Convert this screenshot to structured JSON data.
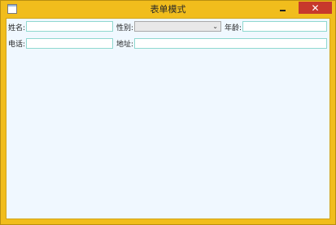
{
  "window": {
    "title": "表单模式"
  },
  "titlebar": {
    "min_icon": "minimize-icon",
    "max_icon": "maximize-icon",
    "close_label": "✕"
  },
  "form": {
    "name_label": "姓名:",
    "name_value": "",
    "gender_label": "性别:",
    "gender_value": "",
    "age_label": "年龄:",
    "age_value": "",
    "phone_label": "电话:",
    "phone_value": "",
    "address_label": "地址:",
    "address_value": ""
  },
  "colors": {
    "frame": "#f1bd1c",
    "client_bg": "#f0f8ff",
    "close_bg": "#c7392c",
    "field_border": "#8fd8d0"
  }
}
